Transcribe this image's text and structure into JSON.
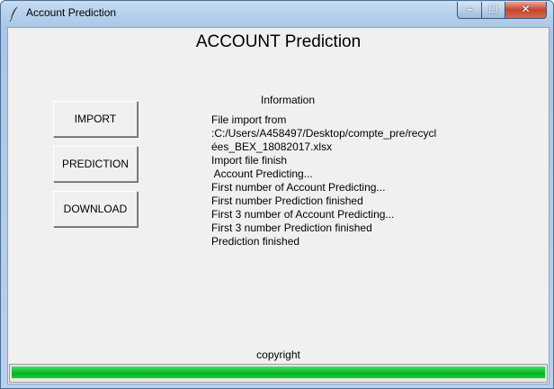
{
  "window": {
    "title": "Account Prediction",
    "controls": {
      "minimize": "–",
      "maximize": "☐",
      "close": "✕"
    }
  },
  "main": {
    "heading": "ACCOUNT Prediction",
    "buttons": {
      "import": "IMPORT",
      "prediction": "PREDICTION",
      "download": "DOWNLOAD"
    },
    "info_label": "Information",
    "info_lines": [
      "File import from",
      ":C:/Users/A458497/Desktop/compte_pre/recycl",
      "ées_BEX_18082017.xlsx",
      "Import file finish",
      " Account Predicting...",
      "First number of Account Predicting...",
      "First number Prediction finished",
      "First 3 number of Account Predicting...",
      "First 3 number Prediction finished",
      "Prediction finished"
    ],
    "copyright": "copyright",
    "progress": {
      "fraction": 1.0,
      "color": "#06b025"
    }
  }
}
